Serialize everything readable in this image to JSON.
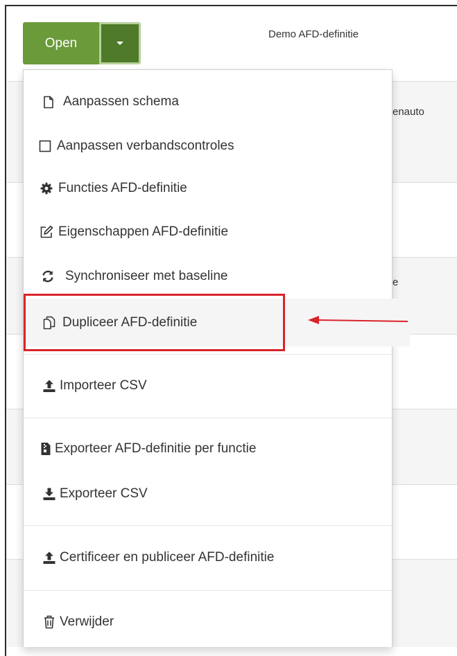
{
  "header": {
    "right_title": "Demo AFD-definitie"
  },
  "background_fragments": {
    "row1_text": "enauto",
    "row3_text": "e"
  },
  "split_button": {
    "label": "Open",
    "caret_icon": "caret-down-icon",
    "color": "#6a9a3a",
    "caret_color": "#4e7a2a"
  },
  "menu": {
    "items": [
      {
        "label": "Aanpassen schema",
        "icon": "file-icon"
      },
      {
        "label": "Aanpassen verbandscontroles",
        "icon": "square-icon"
      },
      {
        "label": "Functies AFD-definitie",
        "icon": "gear-icon"
      },
      {
        "label": "Eigenschappen AFD-definitie",
        "icon": "edit-icon"
      },
      {
        "label": "Synchroniseer met baseline",
        "icon": "refresh-icon"
      },
      {
        "label": "Dupliceer AFD-definitie",
        "icon": "copy-icon",
        "highlighted": true
      },
      {
        "label": "Importeer CSV",
        "icon": "upload-icon"
      },
      {
        "label": "Exporteer AFD-definitie per functie",
        "icon": "archive-icon"
      },
      {
        "label": "Exporteer CSV",
        "icon": "download-icon"
      },
      {
        "label": "Certificeer en publiceer AFD-definitie",
        "icon": "upload-icon"
      },
      {
        "label": "Verwijder",
        "icon": "trash-icon"
      }
    ]
  },
  "annotation": {
    "color": "#d9232b"
  }
}
